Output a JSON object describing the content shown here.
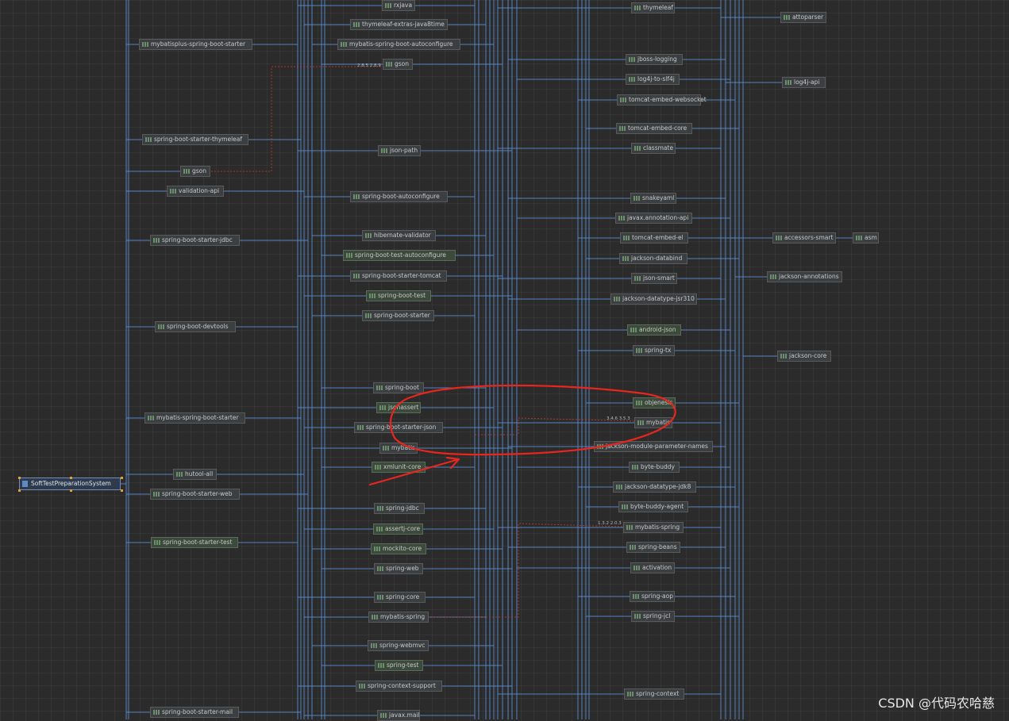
{
  "diagram": {
    "root": "SoftTestPreparationSystem",
    "modules": [
      "rxjava",
      "thymeleaf",
      "attoparser",
      "thymeleaf-extras-java8time",
      "mybatisplus-spring-boot-starter",
      "mybatis-spring-boot-autoconfigure",
      "gson",
      "jboss-logging",
      "log4j-to-slf4j",
      "log4j-api",
      "tomcat-embed-websocket",
      "tomcat-embed-core",
      "spring-boot-starter-thymeleaf",
      "json-path",
      "classmate",
      "validation-api",
      "spring-boot-autoconfigure",
      "snakeyaml",
      "javax.annotation-api",
      "hibernate-validator",
      "tomcat-embed-el",
      "spring-boot-starter-jdbc",
      "accessors-smart",
      "asm",
      "spring-boot-test-autoconfigure",
      "jackson-databind",
      "spring-boot-starter-tomcat",
      "json-smart",
      "jackson-annotations",
      "spring-boot-test",
      "jackson-datatype-jsr310",
      "spring-boot-starter",
      "spring-boot-devtools",
      "android-json",
      "spring-tx",
      "jackson-core",
      "spring-boot",
      "jsonassert",
      "objenesis",
      "mybatis-spring-boot-starter",
      "mybatis",
      "spring-boot-starter-json",
      "jackson-module-parameter-names",
      "xmlunit-core",
      "byte-buddy",
      "hutool-all",
      "jackson-datatype-jdk8",
      "spring-boot-starter-web",
      "byte-buddy-agent",
      "spring-jdbc",
      "mybatis-spring",
      "assertj-core",
      "spring-boot-starter-test",
      "mockito-core",
      "spring-beans",
      "spring-web",
      "activation",
      "spring-core",
      "spring-aop",
      "spring-jcl",
      "spring-webmvc",
      "spring-test",
      "spring-context-support",
      "spring-context",
      "spring-boot-starter-mail",
      "javax.mail"
    ],
    "version_labels": [
      "2.8.5 2.8.9",
      "3.4.6 3.5.3",
      "1.3.2 2.0.3"
    ]
  },
  "watermark": "CSDN @代码农哈慈",
  "colors": {
    "background": "#2b2b2b",
    "edge": "#5a8fd6",
    "conflict_edge": "#c0392b",
    "annotation": "#e8261e",
    "node_fill": "#3c3f41",
    "test_node_fill": "#3b4a3b"
  }
}
